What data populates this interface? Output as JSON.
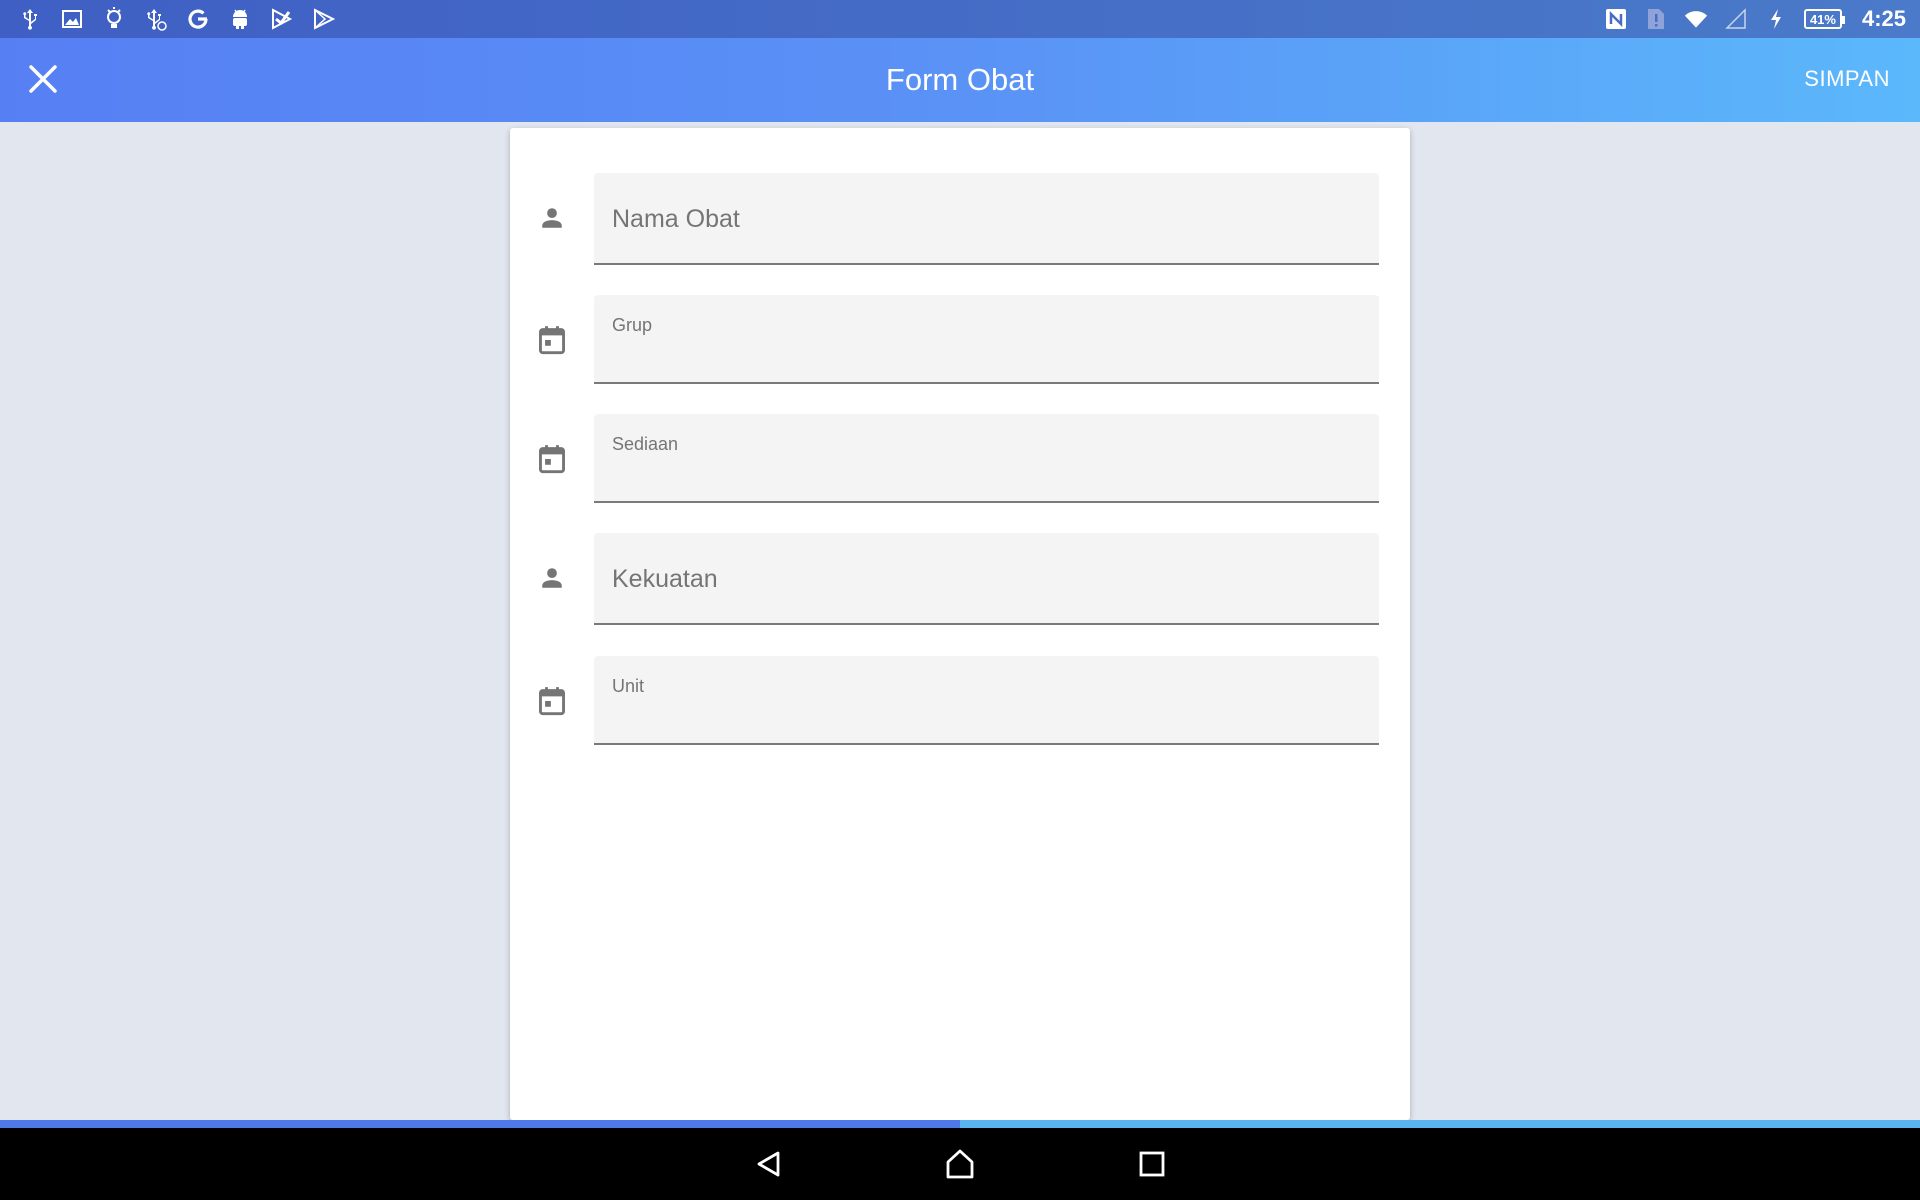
{
  "status_bar": {
    "left_icons": [
      "usb-icon",
      "image-icon",
      "lightbulb-icon",
      "usb-debug-icon",
      "google-icon",
      "android-icon",
      "play-store-icon",
      "play-icon"
    ],
    "battery_percent": "41%",
    "time": "4:25"
  },
  "app_bar": {
    "title": "Form Obat",
    "save_label": "SIMPAN",
    "close_icon": "close-icon"
  },
  "form": {
    "fields": [
      {
        "icon": "person-icon",
        "label": "Nama Obat",
        "value": ""
      },
      {
        "icon": "calendar-icon",
        "label": "Grup",
        "value": ""
      },
      {
        "icon": "calendar-icon",
        "label": "Sediaan",
        "value": ""
      },
      {
        "icon": "person-icon",
        "label": "Kekuatan",
        "value": ""
      },
      {
        "icon": "calendar-icon",
        "label": "Unit",
        "value": ""
      }
    ]
  },
  "colors": {
    "app_bar_start": "#567ff4",
    "app_bar_end": "#5bb8fb",
    "background": "#e2e6ee",
    "icon_gray": "#757575"
  }
}
